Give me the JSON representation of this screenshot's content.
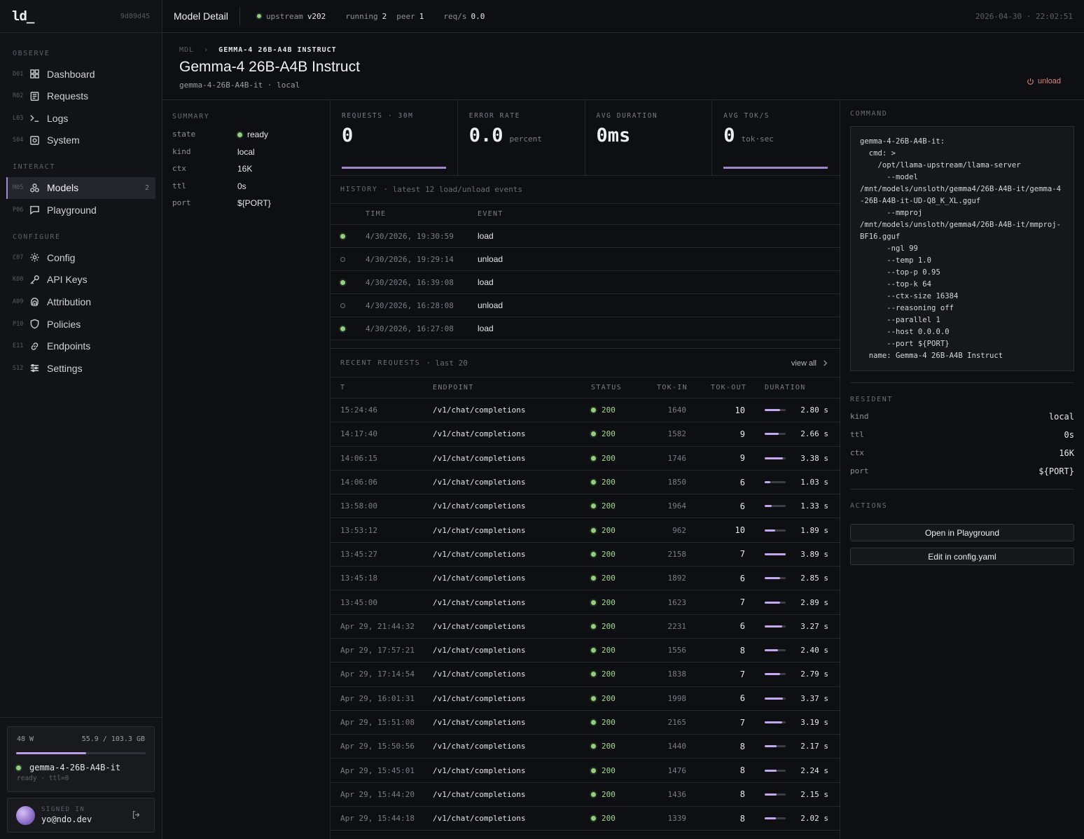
{
  "brand": {
    "logo": "ld_",
    "build": "9d89d45"
  },
  "sidebar": {
    "sections": [
      {
        "title": "OBSERVE",
        "items": [
          {
            "code": "D01",
            "label": "Dashboard",
            "icon": "dashboard-icon"
          },
          {
            "code": "R02",
            "label": "Requests",
            "icon": "requests-icon"
          },
          {
            "code": "L03",
            "label": "Logs",
            "icon": "terminal-icon"
          },
          {
            "code": "S04",
            "label": "System",
            "icon": "system-icon"
          }
        ]
      },
      {
        "title": "INTERACT",
        "items": [
          {
            "code": "M05",
            "label": "Models",
            "icon": "models-icon",
            "count": "2",
            "active": true
          },
          {
            "code": "P06",
            "label": "Playground",
            "icon": "chat-icon"
          }
        ]
      },
      {
        "title": "CONFIGURE",
        "items": [
          {
            "code": "C07",
            "label": "Config",
            "icon": "gear-icon"
          },
          {
            "code": "K08",
            "label": "API Keys",
            "icon": "key-icon"
          },
          {
            "code": "A09",
            "label": "Attribution",
            "icon": "fingerprint-icon"
          },
          {
            "code": "P10",
            "label": "Policies",
            "icon": "shield-icon"
          },
          {
            "code": "E11",
            "label": "Endpoints",
            "icon": "link-icon"
          },
          {
            "code": "S12",
            "label": "Settings",
            "icon": "sliders-icon"
          }
        ]
      }
    ],
    "gpu": {
      "power": "48 W",
      "memory": "55.9 / 103.3 GB",
      "memory_fraction": 0.54,
      "model": "gemma-4-26B-A4B-it",
      "status": "ready · ttl=0"
    },
    "user": {
      "label": "SIGNED IN",
      "email": "yo@ndo.dev"
    }
  },
  "topbar": {
    "title": "Model Detail",
    "upstream_label": "upstream",
    "upstream_version": "v202",
    "running_label": "running",
    "running_count": "2",
    "peer_label": "peer",
    "peer_count": "1",
    "reqs_label": "req/s",
    "reqs_value": "0.0",
    "clock": "2026-04-30 · 22:02:51"
  },
  "header": {
    "crumb_root": "MDL",
    "crumb_current": "GEMMA-4 26B-A4B INSTRUCT",
    "title": "Gemma-4 26B-A4B Instruct",
    "subtitle": "gemma-4-26B-A4B-it · local",
    "unload_label": "unload"
  },
  "summary": {
    "title": "SUMMARY",
    "rows": [
      {
        "k": "state",
        "v": "ready"
      },
      {
        "k": "kind",
        "v": "local"
      },
      {
        "k": "ctx",
        "v": "16K"
      },
      {
        "k": "ttl",
        "v": "0s"
      },
      {
        "k": "port",
        "v": "${PORT}"
      }
    ]
  },
  "stats": [
    {
      "label": "REQUESTS · 30M",
      "value": "0",
      "unit": ""
    },
    {
      "label": "ERROR RATE",
      "value": "0.0",
      "unit": "percent"
    },
    {
      "label": "AVG DURATION",
      "value": "0ms",
      "unit": ""
    },
    {
      "label": "AVG TOK/S",
      "value": "0",
      "unit": "tok·sec"
    }
  ],
  "history": {
    "title": "HISTORY",
    "hint": "· latest 12 load/unload events",
    "cols": [
      "TIME",
      "EVENT"
    ],
    "rows": [
      {
        "time": "4/30/2026, 19:30:59",
        "event": "load",
        "on": true
      },
      {
        "time": "4/30/2026, 19:29:14",
        "event": "unload",
        "on": false
      },
      {
        "time": "4/30/2026, 16:39:08",
        "event": "load",
        "on": true
      },
      {
        "time": "4/30/2026, 16:28:08",
        "event": "unload",
        "on": false
      },
      {
        "time": "4/30/2026, 16:27:08",
        "event": "load",
        "on": true
      }
    ]
  },
  "requests": {
    "title": "RECENT REQUESTS",
    "hint": "· last 20",
    "view_all": "view all",
    "cols": [
      "T",
      "ENDPOINT",
      "STATUS",
      "TOK-IN",
      "TOK-OUT",
      "DURATION"
    ],
    "rows": [
      {
        "t": "15:24:46",
        "ep": "/v1/chat/completions",
        "st": "200",
        "ti": "1640",
        "to": "10",
        "d": "2.80 s",
        "df": 0.72
      },
      {
        "t": "14:17:40",
        "ep": "/v1/chat/completions",
        "st": "200",
        "ti": "1582",
        "to": "9",
        "d": "2.66 s",
        "df": 0.68
      },
      {
        "t": "14:06:15",
        "ep": "/v1/chat/completions",
        "st": "200",
        "ti": "1746",
        "to": "9",
        "d": "3.38 s",
        "df": 0.87
      },
      {
        "t": "14:06:06",
        "ep": "/v1/chat/completions",
        "st": "200",
        "ti": "1850",
        "to": "6",
        "d": "1.03 s",
        "df": 0.26
      },
      {
        "t": "13:58:00",
        "ep": "/v1/chat/completions",
        "st": "200",
        "ti": "1964",
        "to": "6",
        "d": "1.33 s",
        "df": 0.34
      },
      {
        "t": "13:53:12",
        "ep": "/v1/chat/completions",
        "st": "200",
        "ti": "962",
        "to": "10",
        "d": "1.89 s",
        "df": 0.49
      },
      {
        "t": "13:45:27",
        "ep": "/v1/chat/completions",
        "st": "200",
        "ti": "2158",
        "to": "7",
        "d": "3.89 s",
        "df": 1.0
      },
      {
        "t": "13:45:18",
        "ep": "/v1/chat/completions",
        "st": "200",
        "ti": "1892",
        "to": "6",
        "d": "2.85 s",
        "df": 0.73
      },
      {
        "t": "13:45:00",
        "ep": "/v1/chat/completions",
        "st": "200",
        "ti": "1623",
        "to": "7",
        "d": "2.89 s",
        "df": 0.74
      },
      {
        "t": "Apr 29, 21:44:32",
        "ep": "/v1/chat/completions",
        "st": "200",
        "ti": "2231",
        "to": "6",
        "d": "3.27 s",
        "df": 0.84
      },
      {
        "t": "Apr 29, 17:57:21",
        "ep": "/v1/chat/completions",
        "st": "200",
        "ti": "1556",
        "to": "8",
        "d": "2.40 s",
        "df": 0.62
      },
      {
        "t": "Apr 29, 17:14:54",
        "ep": "/v1/chat/completions",
        "st": "200",
        "ti": "1838",
        "to": "7",
        "d": "2.79 s",
        "df": 0.72
      },
      {
        "t": "Apr 29, 16:01:31",
        "ep": "/v1/chat/completions",
        "st": "200",
        "ti": "1998",
        "to": "6",
        "d": "3.37 s",
        "df": 0.87
      },
      {
        "t": "Apr 29, 15:51:08",
        "ep": "/v1/chat/completions",
        "st": "200",
        "ti": "2165",
        "to": "7",
        "d": "3.19 s",
        "df": 0.82
      },
      {
        "t": "Apr 29, 15:50:56",
        "ep": "/v1/chat/completions",
        "st": "200",
        "ti": "1440",
        "to": "8",
        "d": "2.17 s",
        "df": 0.56
      },
      {
        "t": "Apr 29, 15:45:01",
        "ep": "/v1/chat/completions",
        "st": "200",
        "ti": "1476",
        "to": "8",
        "d": "2.24 s",
        "df": 0.58
      },
      {
        "t": "Apr 29, 15:44:20",
        "ep": "/v1/chat/completions",
        "st": "200",
        "ti": "1436",
        "to": "8",
        "d": "2.15 s",
        "df": 0.55
      },
      {
        "t": "Apr 29, 15:44:18",
        "ep": "/v1/chat/completions",
        "st": "200",
        "ti": "1339",
        "to": "8",
        "d": "2.02 s",
        "df": 0.52
      }
    ]
  },
  "right": {
    "command_title": "COMMAND",
    "command": "gemma-4-26B-A4B-it:\n  cmd: >\n    /opt/llama-upstream/llama-server\n      --model\n/mnt/models/unsloth/gemma4/26B-A4B-it/gemma-4-26B-A4B-it-UD-Q8_K_XL.gguf\n      --mmproj\n/mnt/models/unsloth/gemma4/26B-A4B-it/mmproj-BF16.gguf\n      -ngl 99\n      --temp 1.0\n      --top-p 0.95\n      --top-k 64\n      --ctx-size 16384\n      --reasoning off\n      --parallel 1\n      --host 0.0.0.0\n      --port ${PORT}\n  name: Gemma-4 26B-A4B Instruct",
    "resident_title": "RESIDENT",
    "resident": [
      {
        "k": "kind",
        "v": "local"
      },
      {
        "k": "ttl",
        "v": "0s"
      },
      {
        "k": "ctx",
        "v": "16K"
      },
      {
        "k": "port",
        "v": "${PORT}"
      }
    ],
    "actions_title": "ACTIONS",
    "open_playground": "Open in Playground",
    "edit_config": "Edit in config.yaml"
  }
}
